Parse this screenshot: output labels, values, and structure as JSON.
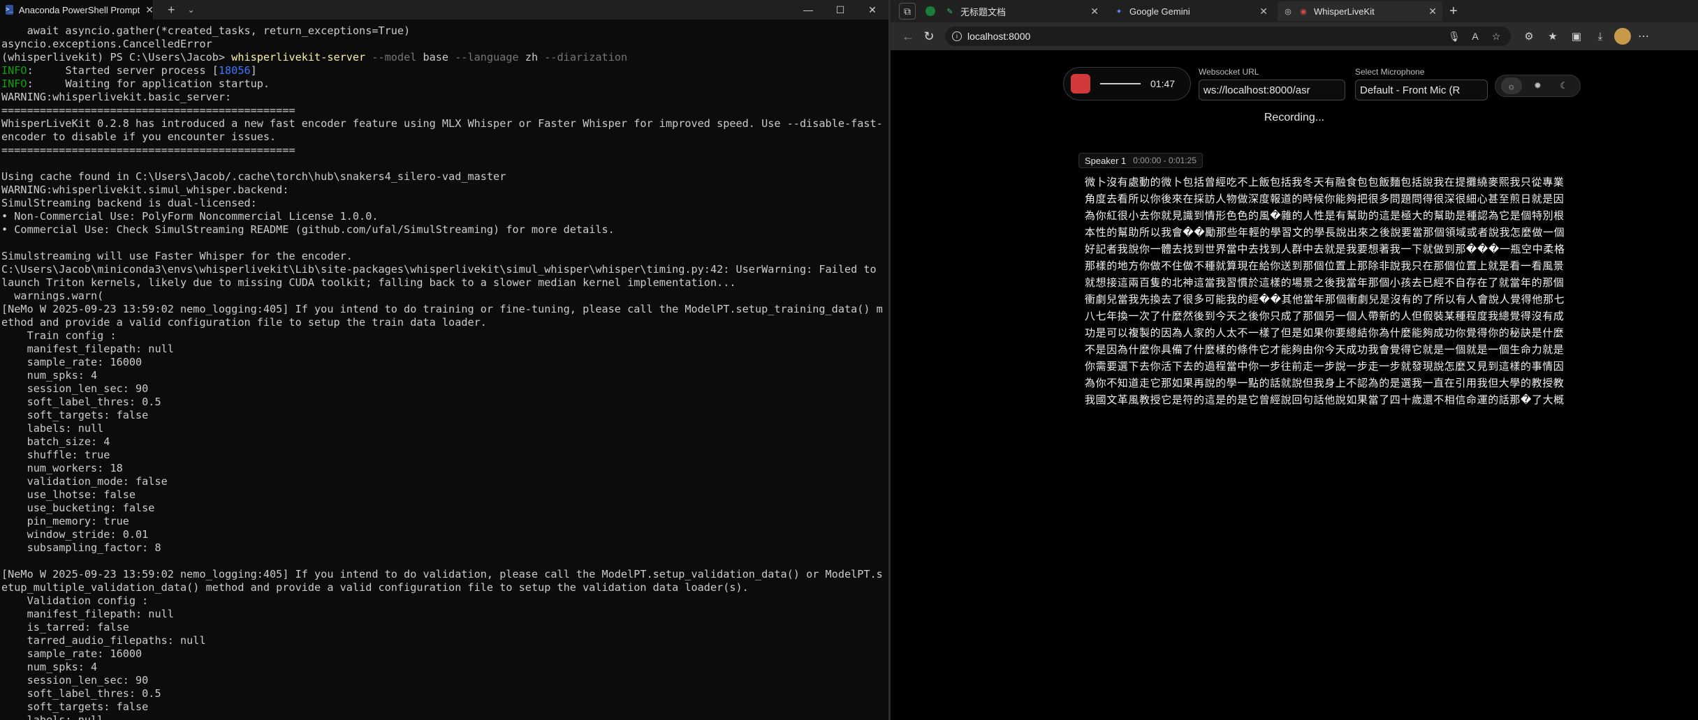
{
  "terminal": {
    "tab_title": "Anaconda PowerShell Prompt",
    "new_tab": "+",
    "dropdown": "⌄",
    "window_controls": [
      "—",
      "☐",
      "✕"
    ],
    "lines": [
      [
        {
          "t": "    await asyncio.gather(*created_tasks, return_exceptions=True)"
        }
      ],
      [
        {
          "t": "asyncio.exceptions.CancelledError"
        }
      ],
      [
        {
          "t": "(whisperlivekit) PS C:\\Users\\Jacob> "
        },
        {
          "t": "whisperlivekit-server",
          "c": "t-cmd"
        },
        {
          "t": " --model",
          "c": "t-flag"
        },
        {
          "t": " base"
        },
        {
          "t": " --language",
          "c": "t-flag"
        },
        {
          "t": " zh"
        },
        {
          "t": " --diarization",
          "c": "t-flag"
        }
      ],
      [
        {
          "t": "INFO",
          "c": "t-info"
        },
        {
          "t": ":     Started server process ["
        },
        {
          "t": "18056",
          "c": "t-num"
        },
        {
          "t": "]"
        }
      ],
      [
        {
          "t": "INFO",
          "c": "t-info"
        },
        {
          "t": ":     Waiting for application startup."
        }
      ],
      [
        {
          "t": "WARNING:whisperlivekit.basic_server:"
        }
      ],
      [
        {
          "t": "=============================================="
        }
      ],
      [
        {
          "t": "WhisperLiveKit 0.2.8 has introduced a new fast encoder feature using MLX Whisper or Faster Whisper for improved speed. Use --disable-fast-"
        }
      ],
      [
        {
          "t": "encoder to disable if you encounter issues."
        }
      ],
      [
        {
          "t": "=============================================="
        }
      ],
      [
        {
          "t": ""
        }
      ],
      [
        {
          "t": "Using cache found in C:\\Users\\Jacob/.cache\\torch\\hub\\snakers4_silero-vad_master"
        }
      ],
      [
        {
          "t": "WARNING:whisperlivekit.simul_whisper.backend:"
        }
      ],
      [
        {
          "t": "SimulStreaming backend is dual-licensed:"
        }
      ],
      [
        {
          "t": "• Non-Commercial Use: PolyForm Noncommercial License 1.0.0."
        }
      ],
      [
        {
          "t": "• Commercial Use: Check SimulStreaming README (github.com/ufal/SimulStreaming) for more details."
        }
      ],
      [
        {
          "t": ""
        }
      ],
      [
        {
          "t": "Simulstreaming will use Faster Whisper for the encoder."
        }
      ],
      [
        {
          "t": "C:\\Users\\Jacob\\miniconda3\\envs\\whisperlivekit\\Lib\\site-packages\\whisperlivekit\\simul_whisper\\whisper\\timing.py:42: UserWarning: Failed to"
        }
      ],
      [
        {
          "t": "launch Triton kernels, likely due to missing CUDA toolkit; falling back to a slower median kernel implementation..."
        }
      ],
      [
        {
          "t": "  warnings.warn("
        }
      ],
      [
        {
          "t": "[NeMo W 2025-09-23 13:59:02 nemo_logging:405] If you intend to do training or fine-tuning, please call the ModelPT.setup_training_data() m"
        }
      ],
      [
        {
          "t": "ethod and provide a valid configuration file to setup the train data loader."
        }
      ],
      [
        {
          "t": "    Train config :"
        }
      ],
      [
        {
          "t": "    manifest_filepath: null"
        }
      ],
      [
        {
          "t": "    sample_rate: 16000"
        }
      ],
      [
        {
          "t": "    num_spks: 4"
        }
      ],
      [
        {
          "t": "    session_len_sec: 90"
        }
      ],
      [
        {
          "t": "    soft_label_thres: 0.5"
        }
      ],
      [
        {
          "t": "    soft_targets: false"
        }
      ],
      [
        {
          "t": "    labels: null"
        }
      ],
      [
        {
          "t": "    batch_size: 4"
        }
      ],
      [
        {
          "t": "    shuffle: true"
        }
      ],
      [
        {
          "t": "    num_workers: 18"
        }
      ],
      [
        {
          "t": "    validation_mode: false"
        }
      ],
      [
        {
          "t": "    use_lhotse: false"
        }
      ],
      [
        {
          "t": "    use_bucketing: false"
        }
      ],
      [
        {
          "t": "    pin_memory: true"
        }
      ],
      [
        {
          "t": "    window_stride: 0.01"
        }
      ],
      [
        {
          "t": "    subsampling_factor: 8"
        }
      ],
      [
        {
          "t": ""
        }
      ],
      [
        {
          "t": "[NeMo W 2025-09-23 13:59:02 nemo_logging:405] If you intend to do validation, please call the ModelPT.setup_validation_data() or ModelPT.s"
        }
      ],
      [
        {
          "t": "etup_multiple_validation_data() method and provide a valid configuration file to setup the validation data loader(s)."
        }
      ],
      [
        {
          "t": "    Validation config :"
        }
      ],
      [
        {
          "t": "    manifest_filepath: null"
        }
      ],
      [
        {
          "t": "    is_tarred: false"
        }
      ],
      [
        {
          "t": "    tarred_audio_filepaths: null"
        }
      ],
      [
        {
          "t": "    sample_rate: 16000"
        }
      ],
      [
        {
          "t": "    num_spks: 4"
        }
      ],
      [
        {
          "t": "    session_len_sec: 90"
        }
      ],
      [
        {
          "t": "    soft_label_thres: 0.5"
        }
      ],
      [
        {
          "t": "    soft_targets: false"
        }
      ],
      [
        {
          "t": "    labels: null"
        }
      ]
    ]
  },
  "browser": {
    "tabs": [
      {
        "title": "无标题文档",
        "icon": "✎",
        "icon_color": "#3fbf6a"
      },
      {
        "title": "Google Gemini",
        "icon": "✦",
        "icon_color": "#5b8cff"
      },
      {
        "title": "WhisperLiveKit",
        "icon": "◉",
        "icon_color": "#d94a4a"
      }
    ],
    "url": "localhost:8000",
    "new_tab": "+"
  },
  "app": {
    "timer": "01:47",
    "websocket_label": "Websocket URL",
    "websocket_value": "ws://localhost:8000/asr",
    "mic_label": "Select Microphone",
    "mic_value": "Default - Front Mic (R",
    "status": "Recording...",
    "speaker": "Speaker 1",
    "time_range": "0:00:00 - 0:01:25",
    "transcript": "微卜沒有處動的微卜包括曾經吃不上飯包括我冬天有融食包包飯麵包括說我在提攤繞麥熙我只從專業角度去看所以你後來在採訪人物做深度報道的時候你能夠把很多問題問得很深很細心甚至煎日就是因為你紅很小去你就見識到情形色色的風�雜的人性是有幫助的這是極大的幫助是種認為它是個特別根本性的幫助所以我會��勵那些年輕的學習文的學長說出來之後說要當那個領域或者說我怎麼做一個好記者我說你一體去找到世界當中去找到人群中去就是我要想著我一下就做到那���一瓶空中柔格那樣的地方你做不住做不種就算現在給你送到那個位置上那除非說我只在那個位置上就是看一看風景就想接這兩百隻的北神這當我習慣於這樣的場景之後我當年那個小孩去已經不自存在了就當年的那個衝劇兒當我先換去了很多可能我的經��其他當年那個衝劇兒是沒有的了所以有人會說人覺得他那七八七年換一次了什麼然後到今天之後你只成了那個另一個人帶新的人但假裝某種程度我總覺得沒有成功是可以複製的因為人家的人太不一樣了但是如果你要總結你為什麼能夠成功你覺得你的秘訣是什麼不是因為什麼你具備了什麼樣的條件它才能夠由你今天成功我會覺得它就是一個就是一個生命力就是你需要選下去你活下去的過程當中你一步往前走一步說一步走一步就發現說怎麼又見到這樣的事情因為你不知道走它那如果再說的學一點的話就說但我身上不認為的是選我一直在引用我但大學的教授教我國文革風教授它是符的這是的是它曾經說回句話他說如果當了四十歲還不相信命運的話那�了大概"
  },
  "colors": {
    "terminal_bg": "#0c0c0c",
    "record_button": "#d23a3a",
    "info_green": "#13a10e",
    "command_yellow": "#f9f1a5"
  }
}
